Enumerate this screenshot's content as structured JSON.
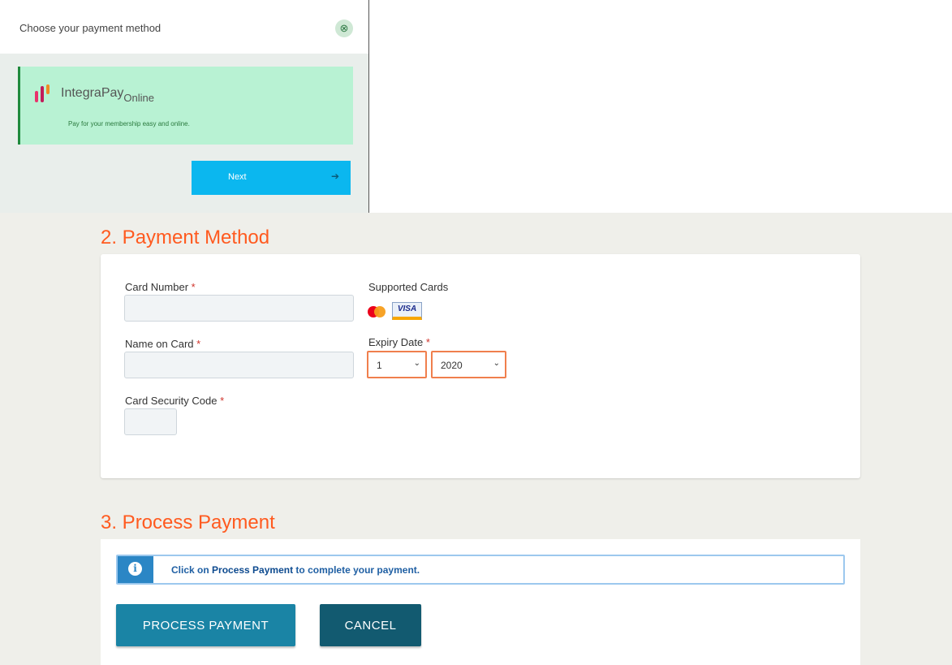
{
  "popup": {
    "title": "Choose your payment method",
    "close_icon": "close-circle-icon",
    "provider": {
      "name": "IntegraPay",
      "name_suffix": "Online",
      "description": "Pay for your membership easy and online.",
      "logo_colors": [
        "#e8336b",
        "#c21b5a",
        "#f08a24"
      ]
    },
    "next_label": "Next",
    "next_icon": "arrow-right-circle-icon"
  },
  "payment_method": {
    "heading": "2. Payment Method",
    "card_number_label": "Card Number",
    "card_number_value": "",
    "name_on_card_label": "Name on Card",
    "name_on_card_value": "",
    "security_code_label": "Card Security Code",
    "security_code_value": "",
    "required_marker": "*",
    "supported_cards_label": "Supported Cards",
    "supported_cards": [
      "mastercard-icon",
      "visa-icon"
    ],
    "visa_text": "VISA",
    "expiry_label": "Expiry Date",
    "expiry_month": "1",
    "expiry_year": "2020"
  },
  "process_payment": {
    "heading": "3. Process Payment",
    "info_prefix": "Click on ",
    "info_link": "Process Payment",
    "info_suffix": " to complete your payment.",
    "process_button": "PROCESS PAYMENT",
    "cancel_button": "CANCEL"
  },
  "colors": {
    "accent_orange": "#ff5a1f",
    "primary_button": "#1a84a5",
    "secondary_button": "#125a70",
    "next_button": "#0bb7ef",
    "provider_bg": "#b8f2d3"
  }
}
